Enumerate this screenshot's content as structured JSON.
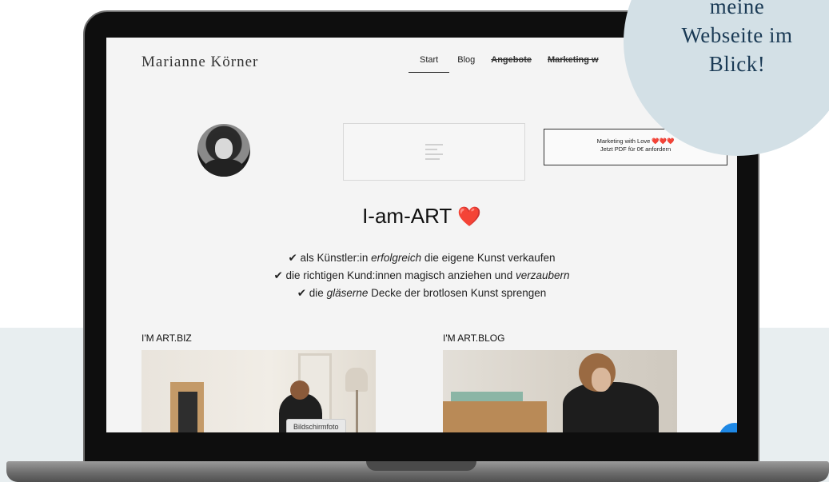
{
  "site": {
    "brand": "Marianne Körner",
    "nav": [
      {
        "label": "Start",
        "state": "active"
      },
      {
        "label": "Blog",
        "state": "normal"
      },
      {
        "label": "Angebote",
        "state": "strike"
      },
      {
        "label": "Marketing w",
        "state": "strike"
      }
    ],
    "promo": {
      "line1": "Marketing with Love ❤️❤️❤️",
      "line2": "Jetzt PDF für 0€ anfordern"
    },
    "hero": {
      "title": "I-am-ART",
      "heart": "❤️",
      "points": [
        {
          "check": "✔",
          "a": " als Künstler:in ",
          "em": "erfolgreich",
          "b": " die eigene Kunst verkaufen"
        },
        {
          "check": "✔",
          "a": " die richtigen Kund:innen magisch anziehen und ",
          "em": "verzaubern",
          "b": ""
        },
        {
          "check": "✔",
          "a": " die ",
          "em": "gläserne",
          "b": " Decke der brotlosen Kunst sprengen"
        }
      ]
    },
    "sections": {
      "biz_label": "I'M ART.BIZ",
      "blog_label": "I'M ART.BLOG"
    },
    "tooltip": "Bildschirmfoto"
  },
  "badge": {
    "lines": [
      "meine",
      "Webseite im",
      "Blick!"
    ]
  },
  "colors": {
    "accent_heart": "#e0242b",
    "badge_bg": "#d3e0e6",
    "badge_text": "#1a3a55",
    "chat_fab": "#1e88e5"
  },
  "icons": {
    "placeholder": "text-lines-icon",
    "chat": "chat-bubble-icon"
  }
}
